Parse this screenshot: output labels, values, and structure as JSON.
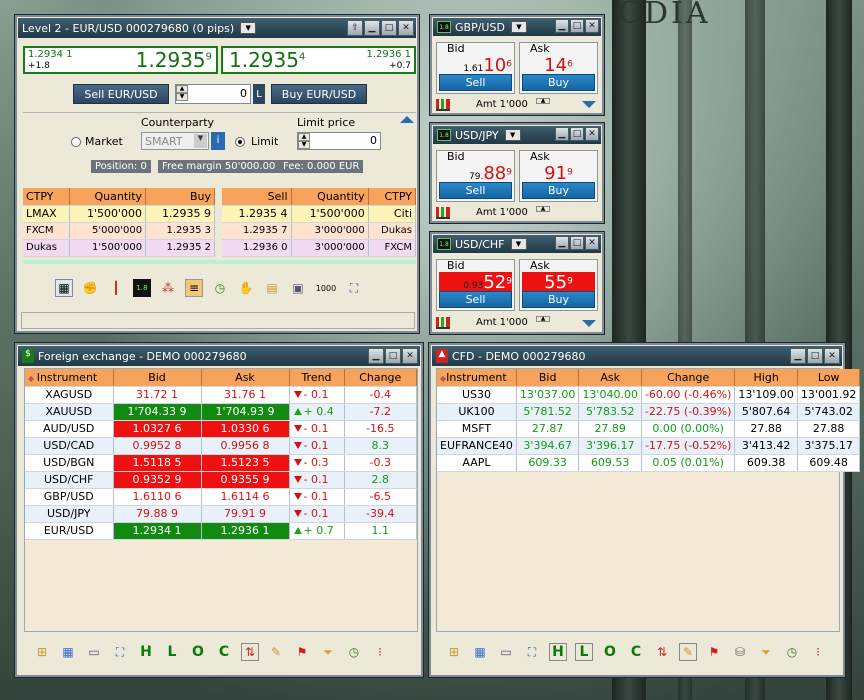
{
  "desktop": {
    "word": "CDIA"
  },
  "level2": {
    "title": "Level 2 - EUR/USD 000279680 (0 pips)",
    "bid_small": "1.2934 1",
    "bid_change": "+1.8",
    "bid_big": "1.2935",
    "bid_sup": "9",
    "ask_small": "1.2936 1",
    "ask_change": "+0.7",
    "ask_big": "1.2935",
    "ask_sup": "4",
    "sell_label": "Sell EUR/USD",
    "qty_value": "0",
    "qty_unit": "L",
    "buy_label": "Buy EUR/USD",
    "counterparty_label": "Counterparty",
    "limit_price_label": "Limit price",
    "market_label": "Market",
    "counterparty_value": "SMART",
    "limit_label": "Limit",
    "limit_value": "0",
    "position": "Position: 0",
    "free_margin": "Free margin  50'000.00",
    "fee": "Fee: 0.000 EUR",
    "bid_headers": [
      "CTPY",
      "Quantity",
      "Buy"
    ],
    "bids": [
      {
        "ctpy": "LMAX",
        "qty": "1'500'000",
        "price": "1.2935 9"
      },
      {
        "ctpy": "FXCM",
        "qty": "5'000'000",
        "price": "1.2935 3"
      },
      {
        "ctpy": "Dukas",
        "qty": "1'500'000",
        "price": "1.2935 2"
      }
    ],
    "ask_headers": [
      "Sell",
      "Quantity",
      "CTPY"
    ],
    "asks": [
      {
        "price": "1.2935 4",
        "qty": "1'500'000",
        "ctpy": "Citi"
      },
      {
        "price": "1.2935 7",
        "qty": "3'000'000",
        "ctpy": "Dukas"
      },
      {
        "price": "1.2936 0",
        "qty": "3'000'000",
        "ctpy": "FXCM"
      }
    ],
    "toolbar_text": "1000"
  },
  "tiles": [
    {
      "pair": "GBP/USD",
      "bid_label": "Bid",
      "ask_label": "Ask",
      "bid_small": "1.61",
      "bid_big": "10",
      "bid_sup": "6",
      "ask_big": "14",
      "ask_sup": "6",
      "sell": "Sell",
      "buy": "Buy",
      "amt": "Amt 1'000",
      "bid_bg": "#ffffff",
      "bid_color": "#d41111",
      "ask_bg": "#ffffff",
      "ask_color": "#d41111"
    },
    {
      "pair": "USD/JPY",
      "bid_label": "Bid",
      "ask_label": "Ask",
      "bid_small": "79.",
      "bid_big": "88",
      "bid_sup": "9",
      "ask_big": "91",
      "ask_sup": "9",
      "sell": "Sell",
      "buy": "Buy",
      "amt": "Amt 1'000",
      "bid_bg": "#ffffff",
      "bid_color": "#d41111",
      "ask_bg": "#ffffff",
      "ask_color": "#d41111"
    },
    {
      "pair": "USD/CHF",
      "bid_label": "Bid",
      "ask_label": "Ask",
      "bid_small": "0.93",
      "bid_big": "52",
      "bid_sup": "9",
      "ask_big": "55",
      "ask_sup": "9",
      "sell": "Sell",
      "buy": "Buy",
      "amt": "Amt 1'000",
      "bid_bg": "#ee1111",
      "bid_color": "#ffffff",
      "ask_bg": "#ee1111",
      "ask_color": "#ffffff"
    }
  ],
  "fx": {
    "title": "Foreign exchange - DEMO 000279680",
    "headers": [
      "Instrument",
      "Bid",
      "Ask",
      "Trend",
      "Change"
    ],
    "rows": [
      {
        "inst": "XAGUSD",
        "bid": "31.72 1",
        "ask": "31.76 1",
        "trend": "- 0.1",
        "dir": "dn",
        "change": "-0.4",
        "hl": ""
      },
      {
        "inst": "XAUUSD",
        "bid": "1'704.33 9",
        "ask": "1'704.93 9",
        "trend": "+ 0.4",
        "dir": "up",
        "change": "-7.2",
        "hl": "green"
      },
      {
        "inst": "AUD/USD",
        "bid": "1.0327 6",
        "ask": "1.0330 6",
        "trend": "- 0.1",
        "dir": "dn",
        "change": "-16.5",
        "hl": "red"
      },
      {
        "inst": "USD/CAD",
        "bid": "0.9952 8",
        "ask": "0.9956 8",
        "trend": "- 0.1",
        "dir": "dn",
        "change": "8.3",
        "hl": ""
      },
      {
        "inst": "USD/BGN",
        "bid": "1.5118 5",
        "ask": "1.5123 5",
        "trend": "- 0.3",
        "dir": "dn",
        "change": "-0.3",
        "hl": "red"
      },
      {
        "inst": "USD/CHF",
        "bid": "0.9352 9",
        "ask": "0.9355 9",
        "trend": "- 0.1",
        "dir": "dn",
        "change": "2.8",
        "hl": "red"
      },
      {
        "inst": "GBP/USD",
        "bid": "1.6110 6",
        "ask": "1.6114 6",
        "trend": "- 0.1",
        "dir": "dn",
        "change": "-6.5",
        "hl": ""
      },
      {
        "inst": "USD/JPY",
        "bid": "79.88 9",
        "ask": "79.91 9",
        "trend": "- 0.1",
        "dir": "dn",
        "change": "-39.4",
        "hl": ""
      },
      {
        "inst": "EUR/USD",
        "bid": "1.2934 1",
        "ask": "1.2936 1",
        "trend": "+ 0.7",
        "dir": "up",
        "change": "1.1",
        "hl": "green"
      }
    ],
    "tools": [
      "H",
      "L",
      "O",
      "C"
    ]
  },
  "cfd": {
    "title": "CFD - DEMO 000279680",
    "headers": [
      "Instrument",
      "Bid",
      "Ask",
      "Change",
      "High",
      "Low"
    ],
    "rows": [
      {
        "inst": "US30",
        "bid": "13'037.00",
        "ask": "13'040.00",
        "change": "-60.00  (-0.46%)",
        "dir": "dn",
        "high": "13'109.00",
        "low": "13'001.92"
      },
      {
        "inst": "UK100",
        "bid": "5'781.52",
        "ask": "5'783.52",
        "change": "-22.75  (-0.39%)",
        "dir": "dn",
        "high": "5'807.64",
        "low": "5'743.02"
      },
      {
        "inst": "MSFT",
        "bid": "27.87",
        "ask": "27.89",
        "change": "0.00  (0.00%)",
        "dir": "up",
        "high": "27.88",
        "low": "27.88"
      },
      {
        "inst": "EUFRANCE40",
        "bid": "3'394.67",
        "ask": "3'396.17",
        "change": "-17.75  (-0.52%)",
        "dir": "dn",
        "high": "3'413.42",
        "low": "3'375.17"
      },
      {
        "inst": "AAPL",
        "bid": "609.33",
        "ask": "609.53",
        "change": "0.05  (0.01%)",
        "dir": "up",
        "high": "609.38",
        "low": "609.48"
      }
    ],
    "tools": [
      "H",
      "L",
      "O",
      "C"
    ]
  }
}
